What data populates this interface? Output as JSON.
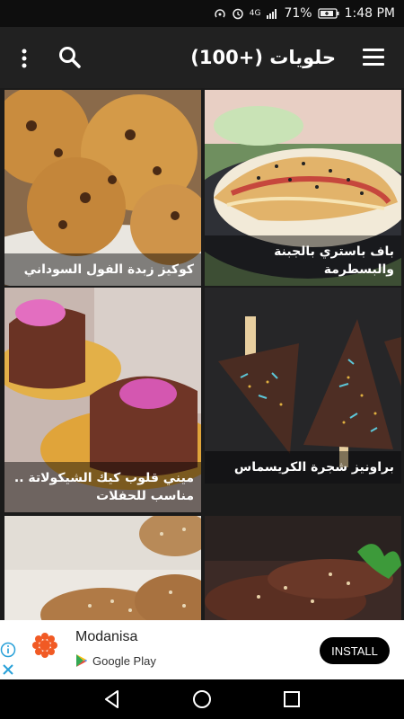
{
  "status_bar": {
    "signal": "4G",
    "battery": "71%",
    "time": "1:48 PM"
  },
  "app_bar": {
    "title": "حلويات (+100)"
  },
  "recipes": [
    {
      "title": "باف باستري بالجبنة والبسطرمة"
    },
    {
      "title": "كوكيز زبدة الفول السوداني"
    },
    {
      "title": "براونيز شجرة الكريسماس"
    },
    {
      "title": "ميني قلوب كيك الشيكولاتة .. مناسب للحفلات"
    },
    {
      "title": ""
    },
    {
      "title": ""
    }
  ],
  "ad": {
    "advertiser": "Modanisa",
    "store": "Google Play",
    "button": "INSTALL"
  },
  "colors": {
    "app_bar": "#212121",
    "status_bar": "#0e0e0e",
    "background": "#1b1b1b",
    "ad_accent": "#f15a24"
  }
}
